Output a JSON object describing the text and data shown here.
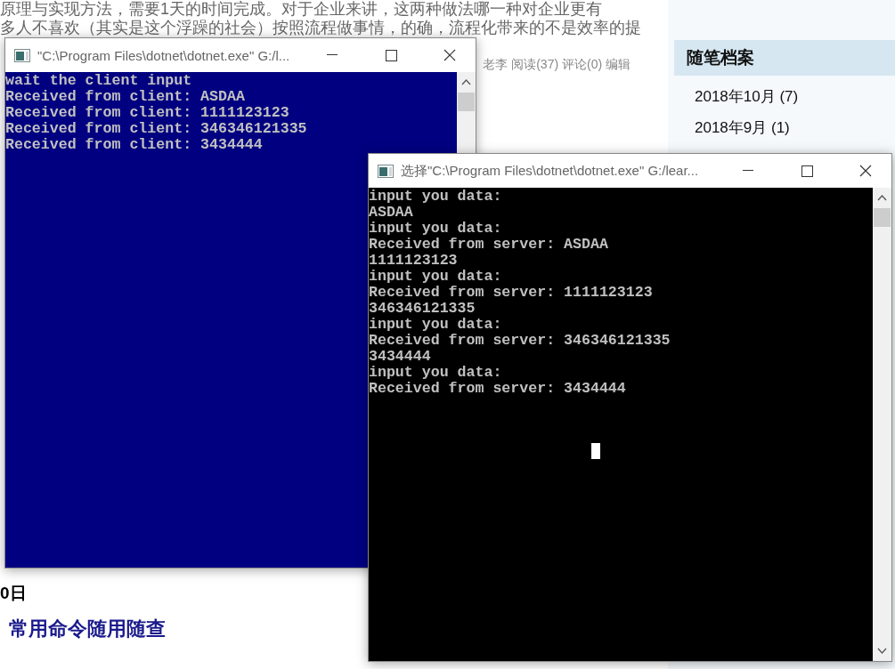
{
  "article": {
    "lines": [
      "原理与实现方法，需要1天的时间完成。对于企业来讲，这两种做法哪一种对企业更有",
      "多人不喜欢（其实是这个浮躁的社会）按照流程做事情，的确，流程化带来的不是效率的提"
    ],
    "meta": "老李 阅读(37) 评论(0) 编辑",
    "date": "0日",
    "post_title": "常用命令随用随查"
  },
  "sidebar": {
    "heading": "随笔档案",
    "items": [
      "2018年10月 (7)",
      "2018年9月 (1)"
    ]
  },
  "windows": [
    {
      "title": "\"C:\\Program Files\\dotnet\\dotnet.exe\" G:/l...",
      "color": "#000080",
      "cursor": false,
      "lines": [
        "wait the client input",
        "Received from client: ASDAA",
        "Received from client: 1111123123",
        "Received from client: 346346121335",
        "Received from client: 3434444"
      ]
    },
    {
      "title": "选择\"C:\\Program Files\\dotnet\\dotnet.exe\" G:/lear...",
      "color": "#000000",
      "cursor": true,
      "lines": [
        "input you data:",
        "ASDAA",
        "input you data:",
        "Received from server: ASDAA",
        "1111123123",
        "input you data:",
        "Received from server: 1111123123",
        "346346121335",
        "input you data:",
        "Received from server: 346346121335",
        "3434444",
        "input you data:",
        "Received from server: 3434444"
      ]
    }
  ]
}
